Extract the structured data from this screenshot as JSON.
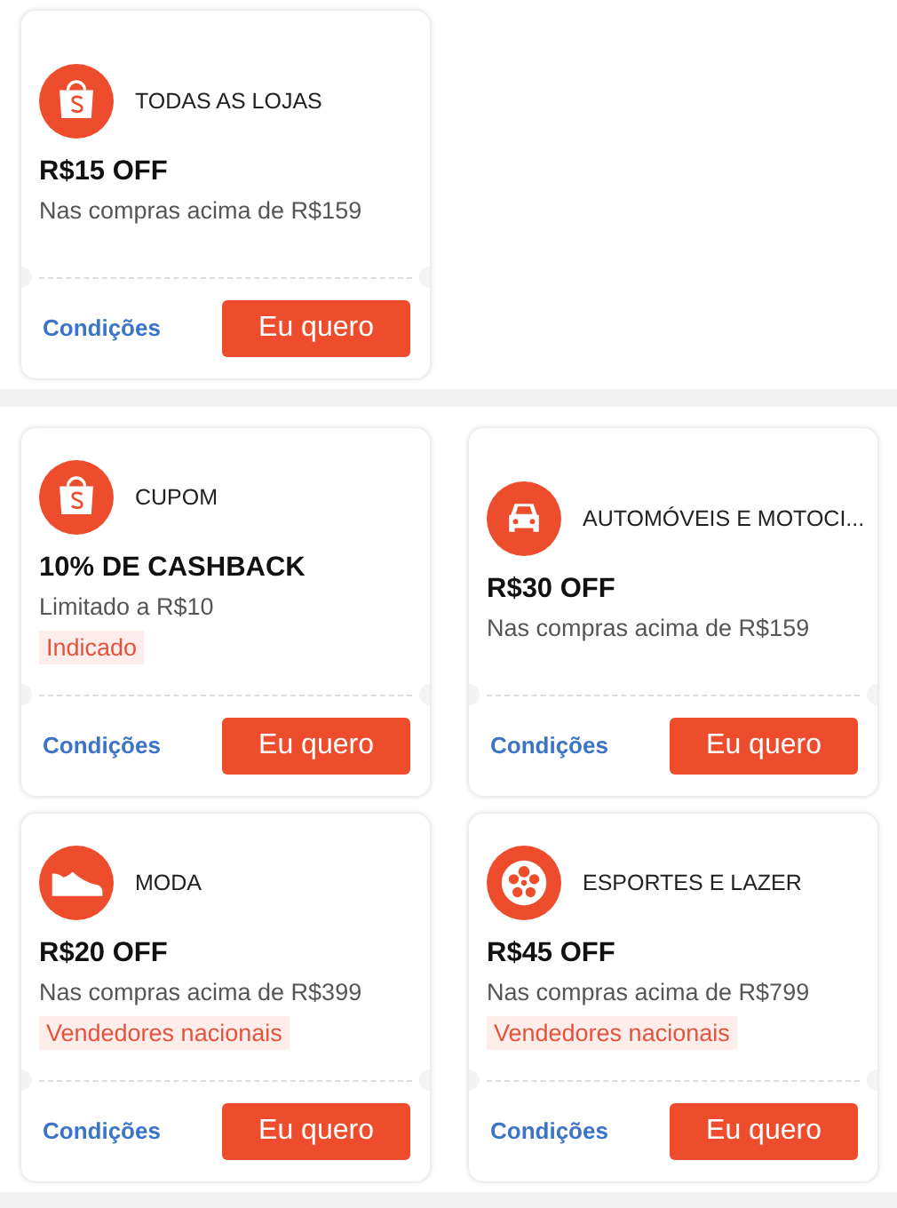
{
  "sections": [
    {
      "coupons": [
        {
          "kind": "bag",
          "title": "TODAS AS LOJAS",
          "amount": "R$15 OFF",
          "condition": "Nas compras acima de R$159",
          "link": "Condições",
          "button": "Eu quero"
        }
      ]
    },
    {
      "coupons": [
        {
          "kind": "bag",
          "title": "CUPOM",
          "amount": "10% DE CASHBACK",
          "condition": "Limitado a R$10",
          "tag": "Indicado",
          "link": "Condições",
          "button": "Eu quero"
        },
        {
          "kind": "car",
          "title": "AUTOMÓVEIS E MOTOCI...",
          "amount": "R$30 OFF",
          "condition": "Nas compras acima de R$159",
          "link": "Condições",
          "button": "Eu quero"
        },
        {
          "kind": "shoe",
          "title": "MODA",
          "amount": "R$20 OFF",
          "condition": "Nas compras acima de R$399",
          "tag": "Vendedores nacionais",
          "link": "Condições",
          "button": "Eu quero"
        },
        {
          "kind": "ball",
          "title": "ESPORTES E LAZER",
          "amount": "R$45 OFF",
          "condition": "Nas compras acima de R$799",
          "tag": "Vendedores nacionais",
          "link": "Condições",
          "button": "Eu quero"
        }
      ]
    }
  ]
}
